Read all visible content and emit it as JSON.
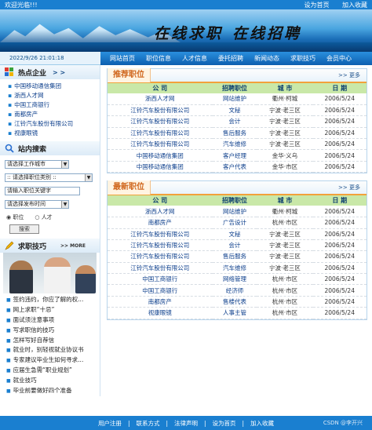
{
  "topbar": {
    "welcome": "欢迎光临!!!",
    "home": "设为首页",
    "fav": "加入收藏"
  },
  "banner": {
    "slogan_1": "在线求职",
    "slogan_2": "在线招聘"
  },
  "date": "2022/9/26 21:01:18",
  "nav": [
    "网站首页",
    "职位信息",
    "人才信息",
    "委托招聘",
    "新闻动态",
    "求职技巧",
    "会员中心"
  ],
  "sidebar": {
    "hot_title": "热点企业",
    "hot_arrows": "> >",
    "enterprises": [
      "中国移动通信集团",
      "浙西人才网",
      "中国工商银行",
      "南都房产",
      "江铃汽车股份有限公司",
      "视康眼镜"
    ],
    "search_title": "站内搜索",
    "city_select": "请选择工作城市",
    "category_select": ":: 请选择职位类别 ::",
    "keyword_input": "请输入职位关键字",
    "time_select": "请选择发布时间",
    "radio_job": "职位",
    "radio_talent": "人才",
    "search_button": "搜索",
    "tips_title": "求职技巧",
    "tips_more": ">> MORE",
    "tips": [
      "签约违约，你应了解的权...",
      "网上求职“十忌”",
      "面试须注意事项",
      "写求职信的技巧",
      "怎样写好自荐信",
      "就业时，别轻视就业协议书",
      "专家建议毕业生如何寻求...",
      "应届生急需“职业规划”",
      "就业技巧",
      "毕业前要做好四个准备"
    ]
  },
  "recommended": {
    "title": "推荐职位",
    "more": ">> 更多",
    "headers": [
      "公 司",
      "招聘职位",
      "城 市",
      "日 期"
    ],
    "rows": [
      [
        "浙西人才网",
        "网站维护",
        "衢州·柯城",
        "2006/5/24"
      ],
      [
        "江铃汽车股份有限公司",
        "文秘",
        "宁波·老三区",
        "2006/5/24"
      ],
      [
        "江铃汽车股份有限公司",
        "会计",
        "宁波·老三区",
        "2006/5/24"
      ],
      [
        "江铃汽车股份有限公司",
        "售后服务",
        "宁波·老三区",
        "2006/5/24"
      ],
      [
        "江铃汽车股份有限公司",
        "汽车维修",
        "宁波·老三区",
        "2006/5/24"
      ],
      [
        "中国移动通信集团",
        "客户经理",
        "金华·义乌",
        "2006/5/24"
      ],
      [
        "中国移动通信集团",
        "客户代表",
        "金华·市区",
        "2006/5/24"
      ]
    ]
  },
  "latest": {
    "title": "最新职位",
    "more": ">> 更多",
    "headers": [
      "公 司",
      "招聘职位",
      "城 市",
      "日 期"
    ],
    "rows": [
      [
        "浙西人才网",
        "网站维护",
        "衢州·柯城",
        "2006/5/24"
      ],
      [
        "南都房产",
        "广告设计",
        "杭州·市区",
        "2006/5/24"
      ],
      [
        "江铃汽车股份有限公司",
        "文秘",
        "宁波·老三区",
        "2006/5/24"
      ],
      [
        "江铃汽车股份有限公司",
        "会计",
        "宁波·老三区",
        "2006/5/24"
      ],
      [
        "江铃汽车股份有限公司",
        "售后服务",
        "宁波·老三区",
        "2006/5/24"
      ],
      [
        "江铃汽车股份有限公司",
        "汽车维修",
        "宁波·老三区",
        "2006/5/24"
      ],
      [
        "中国工商银行",
        "网络管理",
        "杭州·市区",
        "2006/5/24"
      ],
      [
        "中国工商银行",
        "经济师",
        "杭州·市区",
        "2006/5/24"
      ],
      [
        "南都房产",
        "售楼代表",
        "杭州·市区",
        "2006/5/24"
      ],
      [
        "视康眼镜",
        "人事主管",
        "杭州·市区",
        "2006/5/24"
      ]
    ]
  },
  "footer": {
    "links": [
      "用户注册",
      "联系方式",
      "法律声明",
      "设为首页",
      "加入收藏"
    ],
    "separator": "|",
    "watermark": "CSDN @李开兴"
  }
}
